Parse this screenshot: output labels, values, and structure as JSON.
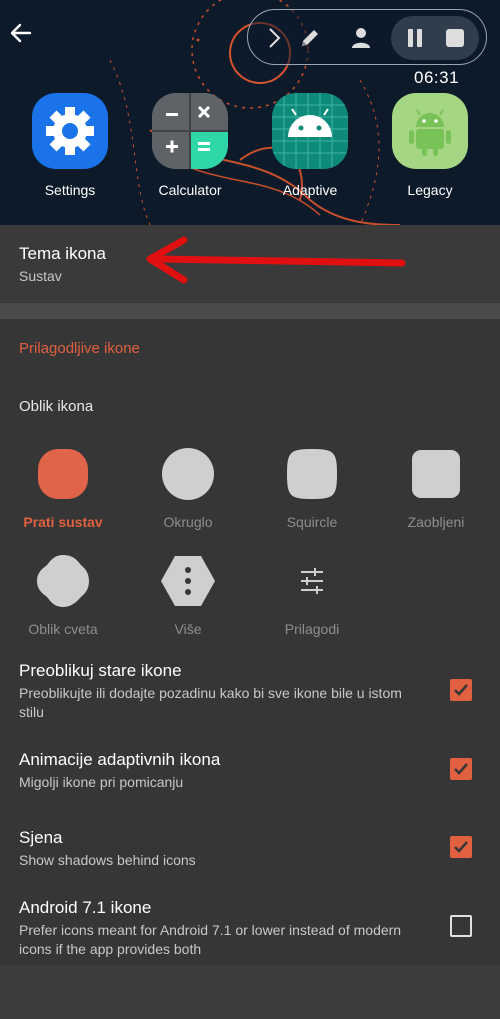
{
  "header": {
    "clock": "06:31",
    "apps": [
      {
        "label": "Settings",
        "icon": "settings-gear-icon"
      },
      {
        "label": "Calculator",
        "icon": "calculator-icon"
      },
      {
        "label": "Adaptive",
        "icon": "android-adaptive-icon"
      },
      {
        "label": "Legacy",
        "icon": "android-legacy-icon"
      }
    ],
    "toolbar_icons": [
      "chevron-right-icon",
      "pencil-icon",
      "person-icon",
      "pause-icon",
      "stop-icon"
    ]
  },
  "icon_theme": {
    "title": "Tema ikona",
    "subtitle": "Sustav"
  },
  "adaptive": {
    "section_title": "Prilagodljive ikone",
    "shape_title": "Oblik ikona",
    "shapes": [
      {
        "label": "Prati sustav",
        "selected": true
      },
      {
        "label": "Okruglo",
        "selected": false
      },
      {
        "label": "Squircle",
        "selected": false
      },
      {
        "label": "Zaobljeni",
        "selected": false
      },
      {
        "label": "Oblik cveta",
        "selected": false
      },
      {
        "label": "Više",
        "selected": false
      },
      {
        "label": "Prilagodi",
        "selected": false
      }
    ]
  },
  "prefs": [
    {
      "title": "Preoblikuj stare ikone",
      "subtitle": "Preoblikujte ili dodajte pozadinu kako bi sve ikone bile u istom stilu",
      "checked": true
    },
    {
      "title": "Animacije adaptivnih ikona",
      "subtitle": "Migolji ikone pri pomicanju",
      "checked": true
    },
    {
      "title": "Sjena",
      "subtitle": "Show shadows behind icons",
      "checked": true
    },
    {
      "title": "Android 7.1 ikone",
      "subtitle": "Prefer icons meant for Android 7.1 or lower instead of modern icons if the app provides both",
      "checked": false
    }
  ],
  "colors": {
    "accent": "#e06040",
    "header_bg": "#0c1a2a",
    "panel_bg": "#363636",
    "annotation_arrow": "#e01010"
  }
}
